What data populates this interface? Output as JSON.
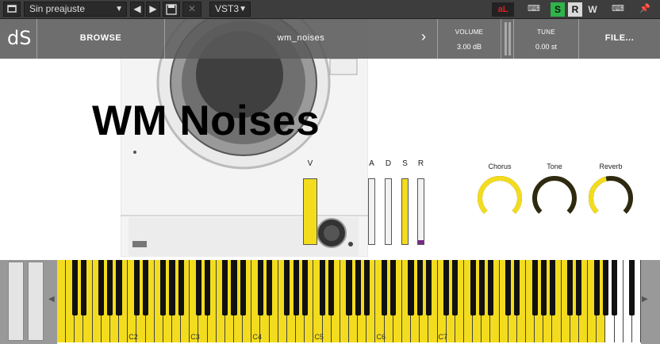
{
  "host": {
    "preset_name": "Sin preajuste",
    "format": "VST3",
    "toggle_s": "S",
    "toggle_r": "R",
    "toggle_w": "W",
    "al_label": "aL",
    "colors": {
      "s_active": "#2fb34a",
      "r_active": "#d9d9d9",
      "al_red": "#e02020"
    }
  },
  "header": {
    "logo": "dS",
    "browse_label": "BROWSE",
    "patch_name": "wm_noises",
    "volume_label": "VOLUME",
    "volume_value": "3.00 dB",
    "tune_label": "TUNE",
    "tune_value": "0.00 st",
    "file_label": "FILE..."
  },
  "main": {
    "title": "WM Noises",
    "sliders": [
      {
        "label": "V",
        "value": 1.0
      },
      {
        "label": "A",
        "value": 0.0
      },
      {
        "label": "D",
        "value": 0.0
      },
      {
        "label": "S",
        "value": 1.0
      },
      {
        "label": "R",
        "value": 0.05
      }
    ],
    "knobs": [
      {
        "label": "Chorus",
        "value": 1.0
      },
      {
        "label": "Tone",
        "value": 0.0
      },
      {
        "label": "Reverb",
        "value": 0.45
      }
    ],
    "accent": "#f3dc1e"
  },
  "keyboard": {
    "octave_labels": [
      "C2",
      "C3",
      "C4",
      "C5",
      "C6",
      "C7"
    ],
    "highlight_color": "#f3dc1e"
  }
}
